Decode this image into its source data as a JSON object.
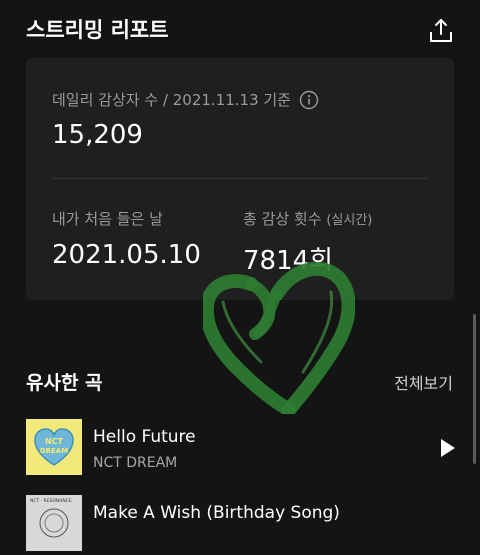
{
  "header": {
    "title": "스트리밍 리포트",
    "share_icon": "share-icon"
  },
  "report": {
    "daily_label": "데일리 감상자 수 / 2021.11.13 기준",
    "daily_value": "15,209",
    "first_listen_label": "내가 처음 들은 날",
    "first_listen_value": "2021.05.10",
    "total_plays_label": "총 감상 횟수",
    "total_plays_sub": "(실시간)",
    "total_plays_value": "7814회"
  },
  "similar": {
    "title": "유사한 곡",
    "see_all": "전체보기",
    "songs": [
      {
        "title": "Hello Future",
        "artist": "NCT DREAM",
        "art_text": "NCT DREAM"
      },
      {
        "title": "Make A Wish (Birthday Song)",
        "artist": "",
        "art_text": "NCT · RESONANCE"
      }
    ]
  },
  "colors": {
    "background": "#141414",
    "card": "#1f1f1f",
    "muted_text": "#9a9a9a",
    "sticker_green": "#2e7d32",
    "album_yellow": "#f1e97a"
  }
}
